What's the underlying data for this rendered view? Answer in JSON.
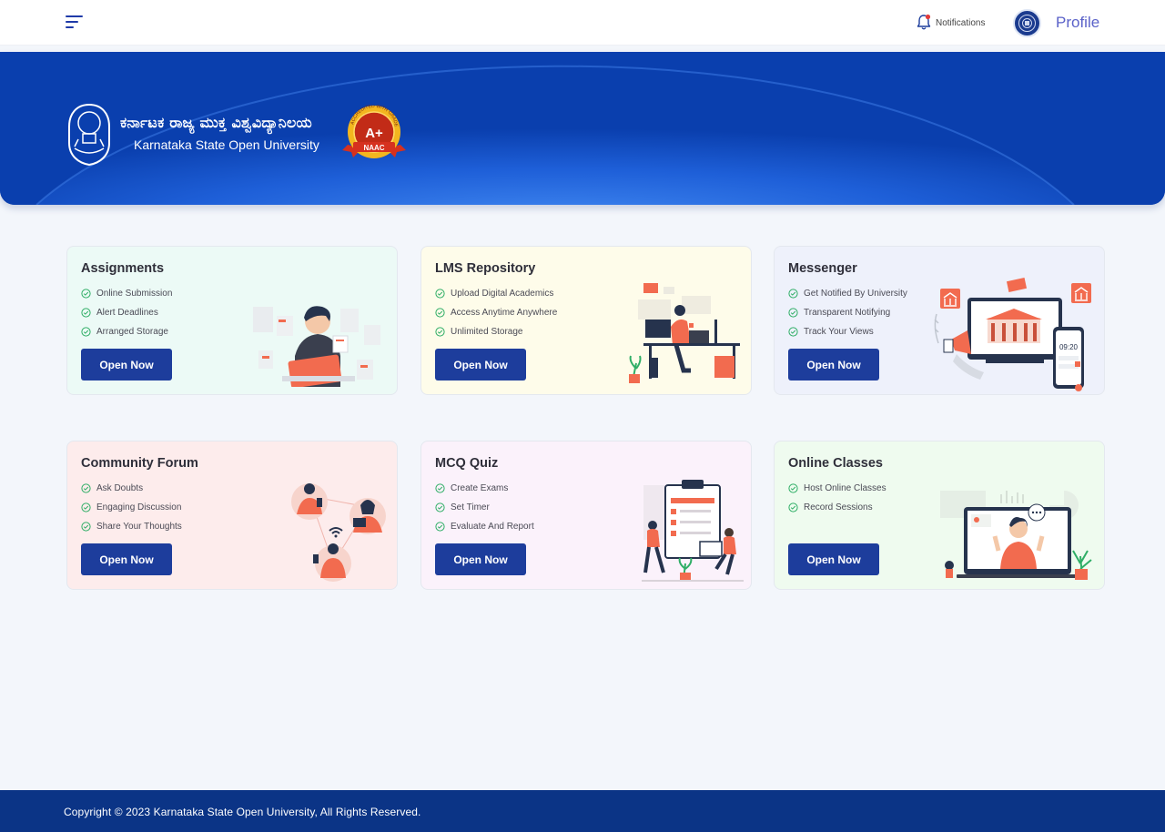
{
  "topbar": {
    "menu_icon": "hamburger-menu-icon",
    "notifications_label": "Notifications",
    "notifications_icon": "bell-icon",
    "profile_label": "Profile"
  },
  "banner": {
    "name_kannada": "ಕರ್ನಾಟಕ ರಾಜ್ಯ ಮುಕ್ತ ವಿಶ್ವವಿದ್ಯಾನಿಲಯ",
    "name_english": "Karnataka State Open University",
    "naac_grade": "A+",
    "naac_label": "NAAC",
    "naac_ring_text": "ACCREDITED WITH GRADE"
  },
  "cards": [
    {
      "title": "Assignments",
      "features": [
        "Online Submission",
        "Alert Deadlines",
        "Arranged Storage"
      ],
      "button": "Open Now",
      "bg": "#ecfaf6"
    },
    {
      "title": "LMS Repository",
      "features": [
        "Upload Digital Academics",
        "Access Anytime Anywhere",
        "Unlimited Storage"
      ],
      "button": "Open Now",
      "bg": "#fefcea"
    },
    {
      "title": "Messenger",
      "features": [
        "Get Notified By University",
        "Transparent Notifying",
        "Track Your Views"
      ],
      "button": "Open Now",
      "bg": "#eef1fb",
      "clock": "09:20"
    },
    {
      "title": "Community Forum",
      "features": [
        "Ask Doubts",
        "Engaging Discussion",
        "Share Your Thoughts"
      ],
      "button": "Open Now",
      "bg": "#fdecec"
    },
    {
      "title": "MCQ Quiz",
      "features": [
        "Create Exams",
        "Set Timer",
        "Evaluate And Report"
      ],
      "button": "Open Now",
      "bg": "#fbf2fb"
    },
    {
      "title": "Online Classes",
      "features": [
        "Host Online Classes",
        "Record Sessions"
      ],
      "button": "Open Now",
      "bg": "#effbef"
    }
  ],
  "footer": {
    "copyright": "Copyright © 2023 Karnataka State Open University, All Rights Reserved."
  },
  "colors": {
    "brand_blue": "#1d3d9c",
    "banner_blue": "#0a3fae",
    "footer_blue": "#0b3486",
    "illustration_accent": "#f26b4f"
  }
}
